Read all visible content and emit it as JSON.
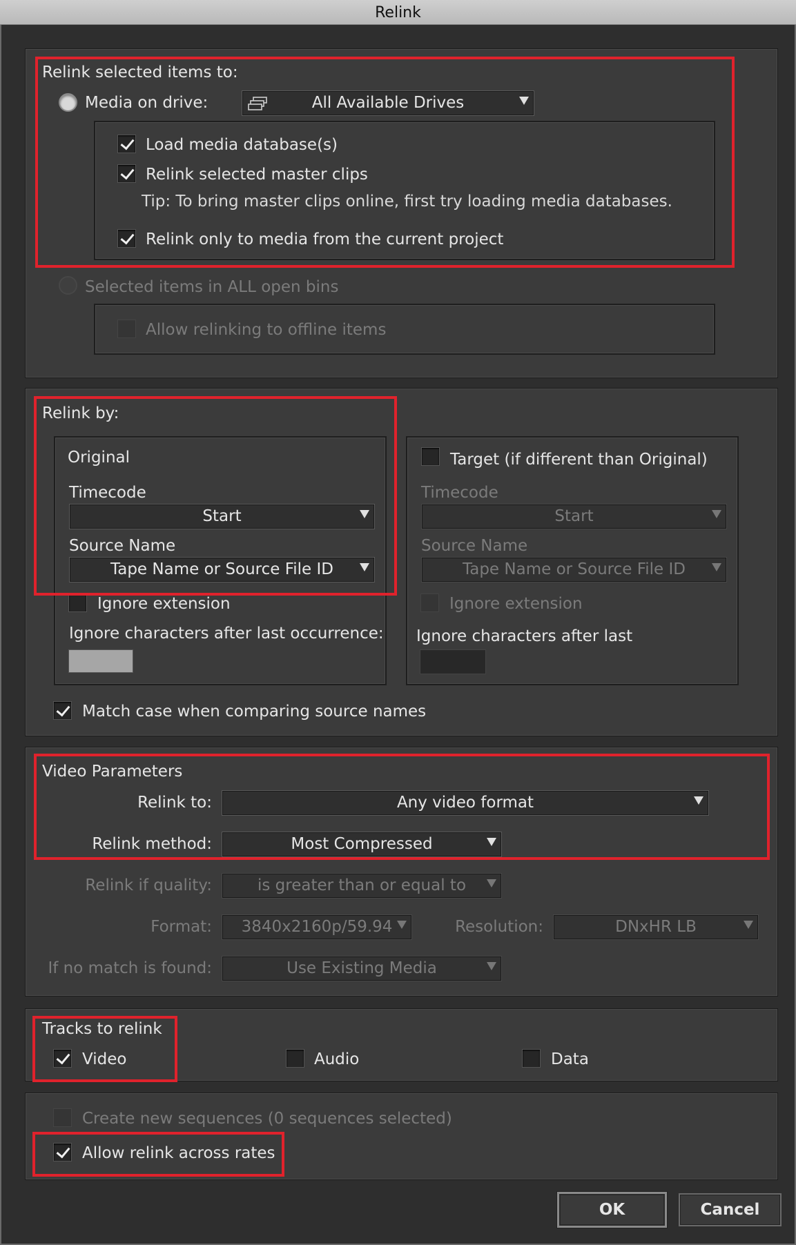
{
  "window": {
    "title": "Relink"
  },
  "relink_items": {
    "section_label": "Relink selected items to:",
    "media_on_drive": {
      "label": "Media on drive:",
      "selected": false
    },
    "drive_select": {
      "value": "All Available Drives",
      "icon": "drive-icon"
    },
    "load_db": {
      "label": "Load media database(s)",
      "checked": true
    },
    "relink_master": {
      "label": "Relink selected master clips",
      "checked": true
    },
    "tip": "Tip: To bring master clips online, first try loading media databases.",
    "relink_current_project": {
      "label": "Relink only to media from the current project",
      "checked": true
    },
    "selected_items_all_bins": {
      "label": "Selected items in ALL open bins",
      "enabled": false
    },
    "allow_offline": {
      "label": "Allow relinking to offline items",
      "checked": false,
      "enabled": false
    }
  },
  "relink_by": {
    "section_label": "Relink by:",
    "original": {
      "title": "Original",
      "timecode_label": "Timecode",
      "timecode_value": "Start",
      "source_name_label": "Source Name",
      "source_name_value": "Tape Name or Source File ID",
      "ignore_extension": {
        "label": "Ignore extension",
        "checked": false
      },
      "ignore_chars_label": "Ignore characters after last occurrence:"
    },
    "target": {
      "title": "Target (if different than Original)",
      "checked": false,
      "timecode_label": "Timecode",
      "timecode_value": "Start",
      "source_name_label": "Source Name",
      "source_name_value": "Tape Name or Source File ID",
      "ignore_extension": {
        "label": "Ignore extension",
        "checked": false
      },
      "ignore_chars_label": "Ignore characters after last"
    },
    "match_case": {
      "label": "Match case when comparing source names",
      "checked": true
    }
  },
  "video_params": {
    "section_label": "Video Parameters",
    "relink_to": {
      "label": "Relink to:",
      "value": "Any video format"
    },
    "relink_method": {
      "label": "Relink method:",
      "value": "Most Compressed"
    },
    "relink_if_quality": {
      "label": "Relink if quality:",
      "value": "is greater than or equal to"
    },
    "format": {
      "label": "Format:",
      "value": "3840x2160p/59.94"
    },
    "resolution": {
      "label": "Resolution:",
      "value": "DNxHR LB"
    },
    "if_no_match": {
      "label": "If no match is found:",
      "value": "Use Existing Media"
    }
  },
  "tracks": {
    "section_label": "Tracks to relink",
    "video": {
      "label": "Video",
      "checked": true
    },
    "audio": {
      "label": "Audio",
      "checked": false
    },
    "data": {
      "label": "Data",
      "checked": false
    }
  },
  "sequences": {
    "create_new": {
      "label": "Create new sequences  (0 sequences selected)",
      "checked": false,
      "enabled": false
    },
    "allow_across_rates": {
      "label": "Allow relink across rates",
      "checked": true
    }
  },
  "buttons": {
    "ok": "OK",
    "cancel": "Cancel"
  },
  "colors": {
    "highlight": "#e0222c",
    "panel": "#3b3b3b",
    "background": "#2e2e2e"
  }
}
